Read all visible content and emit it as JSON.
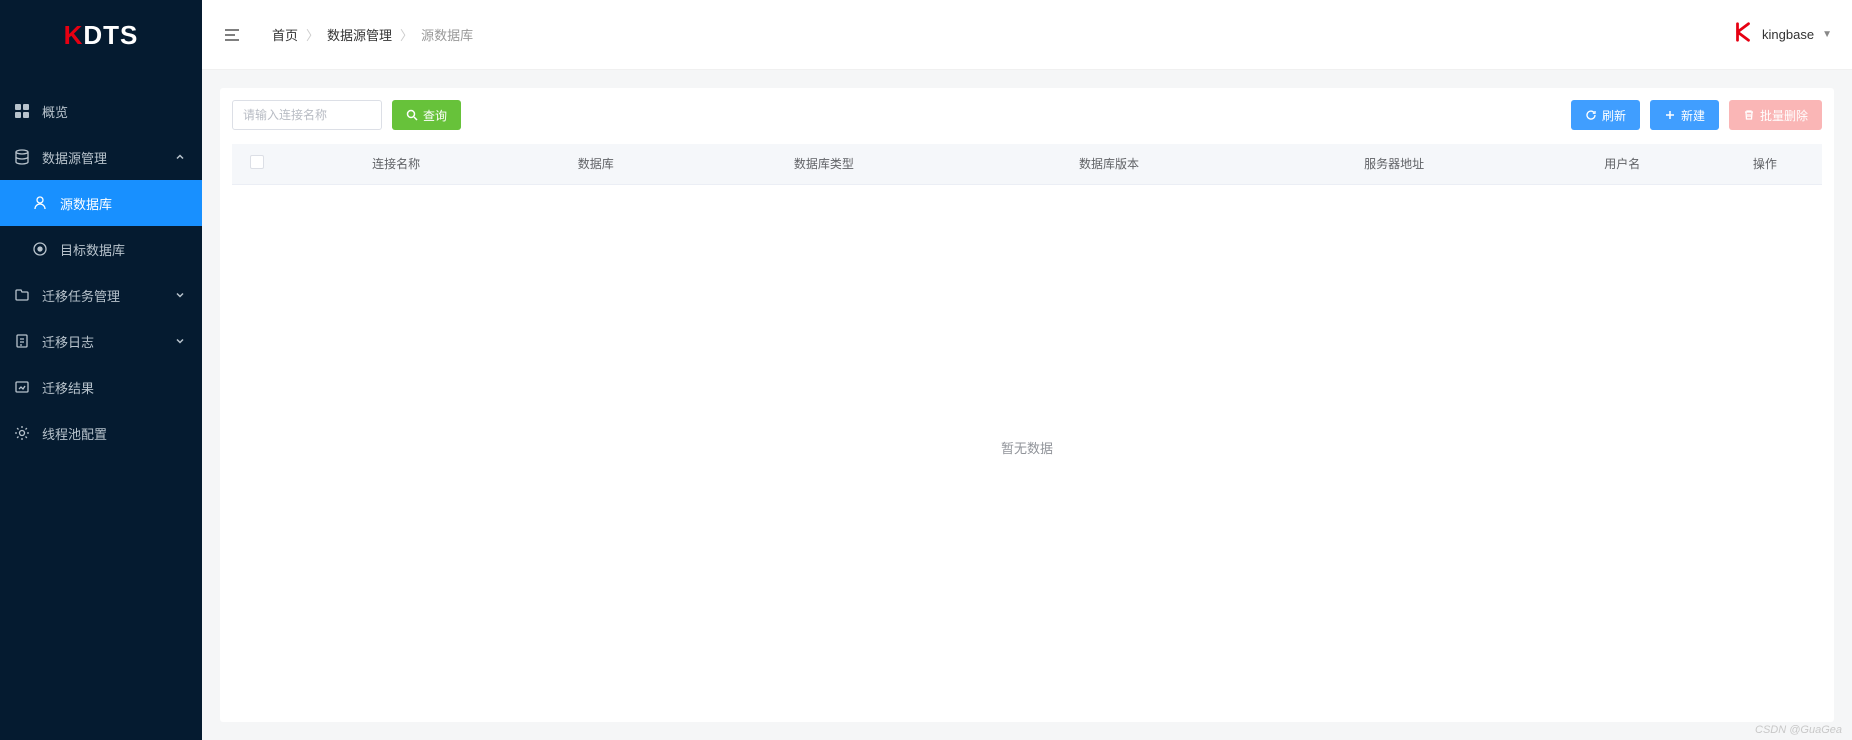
{
  "app": {
    "logo_prefix": "K",
    "logo_rest": "DTS"
  },
  "sidebar": {
    "items": [
      {
        "label": "概览",
        "icon": "grid-icon",
        "expandable": false
      },
      {
        "label": "数据源管理",
        "icon": "database-icon",
        "expandable": true,
        "expanded": true
      },
      {
        "label": "迁移任务管理",
        "icon": "folder-icon",
        "expandable": true,
        "expanded": false
      },
      {
        "label": "迁移日志",
        "icon": "document-icon",
        "expandable": true,
        "expanded": false
      },
      {
        "label": "迁移结果",
        "icon": "result-icon",
        "expandable": false
      },
      {
        "label": "线程池配置",
        "icon": "gear-icon",
        "expandable": false
      }
    ],
    "subitems_datasource": [
      {
        "label": "源数据库",
        "icon": "source-db-icon",
        "active": true
      },
      {
        "label": "目标数据库",
        "icon": "target-db-icon",
        "active": false
      }
    ]
  },
  "breadcrumb": {
    "items": [
      {
        "label": "首页",
        "current": false
      },
      {
        "label": "数据源管理",
        "current": false
      },
      {
        "label": "源数据库",
        "current": true
      }
    ]
  },
  "user": {
    "name": "kingbase"
  },
  "toolbar": {
    "search_placeholder": "请输入连接名称",
    "query_label": "查询",
    "refresh_label": "刷新",
    "create_label": "新建",
    "bulk_delete_label": "批量删除"
  },
  "table": {
    "columns": [
      "连接名称",
      "数据库",
      "数据库类型",
      "数据库版本",
      "服务器地址",
      "用户名",
      "操作"
    ],
    "empty_text": "暂无数据",
    "rows": []
  },
  "watermark": "CSDN @GuaGea"
}
